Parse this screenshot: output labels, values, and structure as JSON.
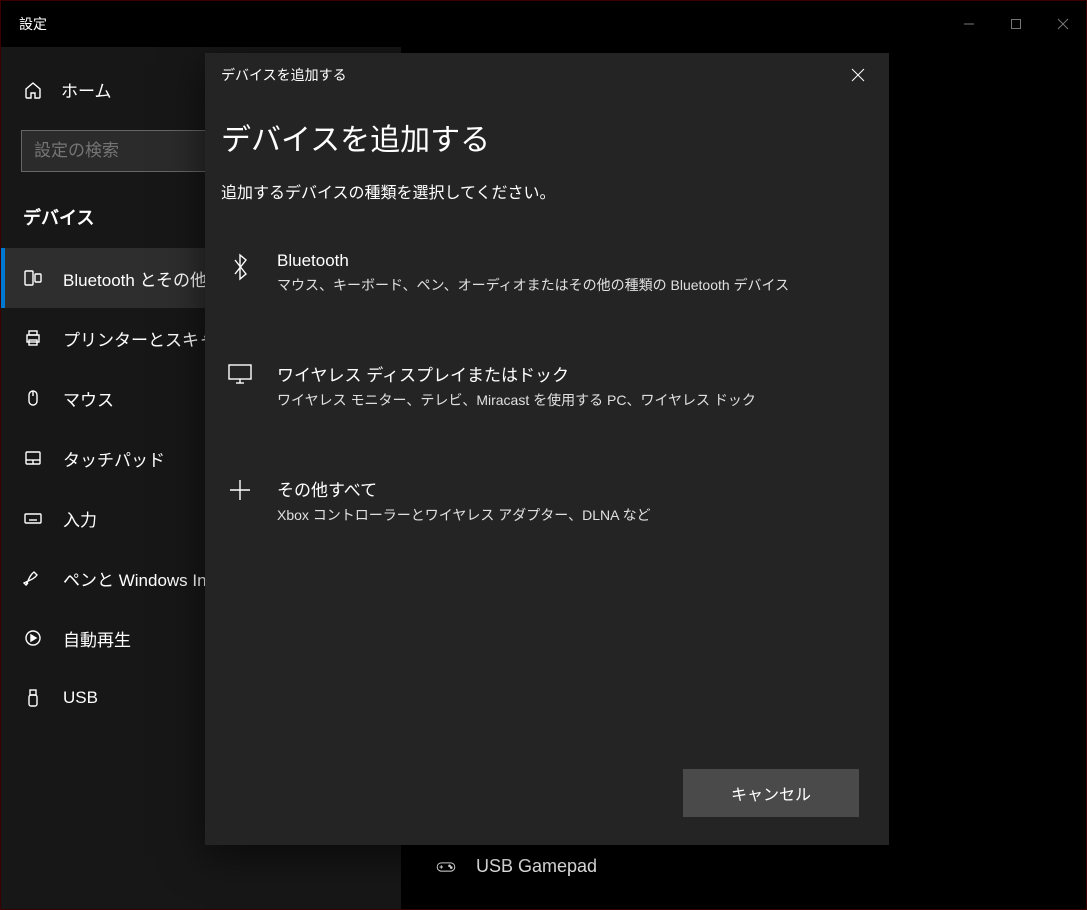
{
  "window": {
    "title": "設定"
  },
  "sidebar": {
    "home_label": "ホーム",
    "search_placeholder": "設定の検索",
    "category": "デバイス",
    "items": [
      {
        "label": "Bluetooth とその他のデバイス"
      },
      {
        "label": "プリンターとスキャナー"
      },
      {
        "label": "マウス"
      },
      {
        "label": "タッチパッド"
      },
      {
        "label": "入力"
      },
      {
        "label": "ペンと Windows Ink"
      },
      {
        "label": "自動再生"
      },
      {
        "label": "USB"
      }
    ]
  },
  "content": {
    "device_label": "USB Gamepad"
  },
  "dialog": {
    "titlebar": "デバイスを追加する",
    "heading": "デバイスを追加する",
    "subtitle": "追加するデバイスの種類を選択してください。",
    "options": [
      {
        "title": "Bluetooth",
        "desc": "マウス、キーボード、ペン、オーディオまたはその他の種類の Bluetooth デバイス"
      },
      {
        "title": "ワイヤレス ディスプレイまたはドック",
        "desc": "ワイヤレス モニター、テレビ、Miracast を使用する PC、ワイヤレス ドック"
      },
      {
        "title": "その他すべて",
        "desc": "Xbox コントローラーとワイヤレス アダプター、DLNA など"
      }
    ],
    "cancel": "キャンセル"
  }
}
